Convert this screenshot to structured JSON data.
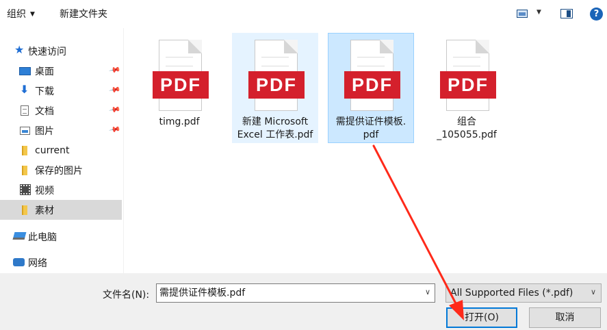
{
  "toolbar": {
    "organize_label": "组织",
    "new_folder_label": "新建文件夹"
  },
  "sidebar": {
    "items": [
      {
        "label": "快速访问",
        "icon": "star-icon"
      },
      {
        "label": "桌面",
        "icon": "desktop-icon",
        "pinned": true
      },
      {
        "label": "下载",
        "icon": "download-arrow-icon",
        "pinned": true
      },
      {
        "label": "文档",
        "icon": "document-icon",
        "pinned": true
      },
      {
        "label": "图片",
        "icon": "pictures-icon",
        "pinned": true
      },
      {
        "label": "current",
        "icon": "folder-icon"
      },
      {
        "label": "保存的图片",
        "icon": "folder-icon"
      },
      {
        "label": "视频",
        "icon": "video-icon"
      },
      {
        "label": "素材",
        "icon": "folder-icon",
        "selected": true
      },
      {
        "label": "此电脑",
        "icon": "computer-icon"
      },
      {
        "label": "网络",
        "icon": "network-icon"
      }
    ]
  },
  "files": [
    {
      "name_line1": "timg.pdf",
      "name_line2": "",
      "badge": "PDF",
      "state": "normal"
    },
    {
      "name_line1": "新建 Microsoft",
      "name_line2": "Excel 工作表.pdf",
      "badge": "PDF",
      "state": "hover"
    },
    {
      "name_line1": "需提供证件模板.",
      "name_line2": "pdf",
      "badge": "PDF",
      "state": "selected"
    },
    {
      "name_line1": "组合",
      "name_line2": "_105055.pdf",
      "badge": "PDF",
      "state": "normal"
    }
  ],
  "bottom": {
    "filename_label": "文件名(N):",
    "filename_value": "需提供证件模板.pdf",
    "filetype_value": "All Supported Files (*.pdf)",
    "open_label": "打开(O)",
    "cancel_label": "取消"
  },
  "colors": {
    "pdf_band": "#d4202c",
    "selection": "#cce8ff",
    "hover": "#e5f3ff",
    "focus_border": "#0078d7",
    "annotation_arrow": "#ff2a1a"
  }
}
